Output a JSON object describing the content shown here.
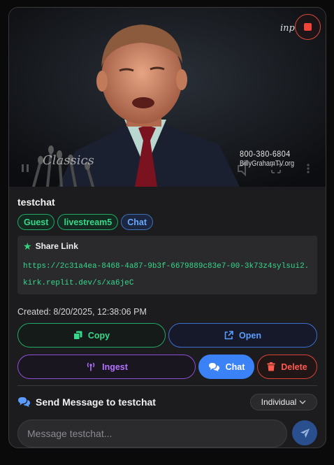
{
  "stream": {
    "title": "testchat",
    "tags": [
      {
        "label": "Guest",
        "color": "#36d98a"
      },
      {
        "label": "livestream5",
        "color": "#36d98a"
      },
      {
        "label": "Chat",
        "color": "#6aa7ff"
      }
    ],
    "video": {
      "watermark_phone": "800-380-6804",
      "watermark_site": "BillyGrahamTV.org",
      "watermark_classics": "Classics",
      "watermark_corner": "inp",
      "stop_icon": "stop-icon"
    },
    "share": {
      "heading": "Share Link",
      "url": "https://2c31a4ea-8468-4a87-9b3f-6679889c83e7-00-3k73z4sylsui2.kirk.replit.dev/s/xa6jeC"
    },
    "created": "Created: 8/20/2025, 12:38:06 PM",
    "actions": {
      "copy": "Copy",
      "open": "Open",
      "ingest": "Ingest",
      "chat": "Chat",
      "delete": "Delete"
    },
    "message": {
      "heading": "Send Message to testchat",
      "mode": "Individual",
      "placeholder": "Message testchat..."
    }
  },
  "colors": {
    "green": "#36d98a",
    "blue": "#3b82f6",
    "purple": "#b173ff",
    "red": "#ff5a4e"
  }
}
